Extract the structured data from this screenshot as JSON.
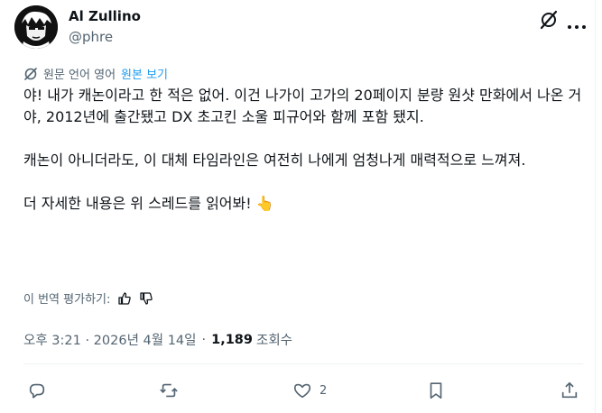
{
  "author": {
    "name": "Al Zullino",
    "handle": "@phre"
  },
  "translation": {
    "label": "원문 언어 영어",
    "show_original": "원본 보기"
  },
  "post": {
    "paragraphs": [
      "야! 내가 캐논이라고 한 적은 없어. 이건 나가이 고가의 20페이지 분량 원샷 만화에서 나온 거야, 2012년에 출간됐고 DX 초고킨 소울 피규어와 함께 포함 됐지.",
      "캐논이 아니더라도, 이 대체 타임라인은 여전히 나에게 엄청나게 매력적으로 느껴져.",
      "더 자세한 내용은 위 스레드를 읽어봐!"
    ],
    "emoji": "👆"
  },
  "rating": {
    "label": "이 번역 평가하기:"
  },
  "meta": {
    "timestamp": "오후 3:21 · 2026년 4월 14일",
    "dot": "·",
    "views_count": "1,189",
    "views_label": "조회수"
  },
  "actions": {
    "reply_count": "",
    "repost_count": "",
    "like_count": "2",
    "bookmark_count": ""
  },
  "icons": [
    "avatar",
    "grok-icon",
    "more-icon",
    "translate-icon",
    "thumbs-up-icon",
    "thumbs-down-icon",
    "reply-icon",
    "repost-icon",
    "like-icon",
    "bookmark-icon",
    "share-icon"
  ],
  "colors": {
    "text_primary": "#0f1419",
    "text_secondary": "#536471",
    "accent": "#1d9bf0",
    "divider": "#eff3f4"
  }
}
